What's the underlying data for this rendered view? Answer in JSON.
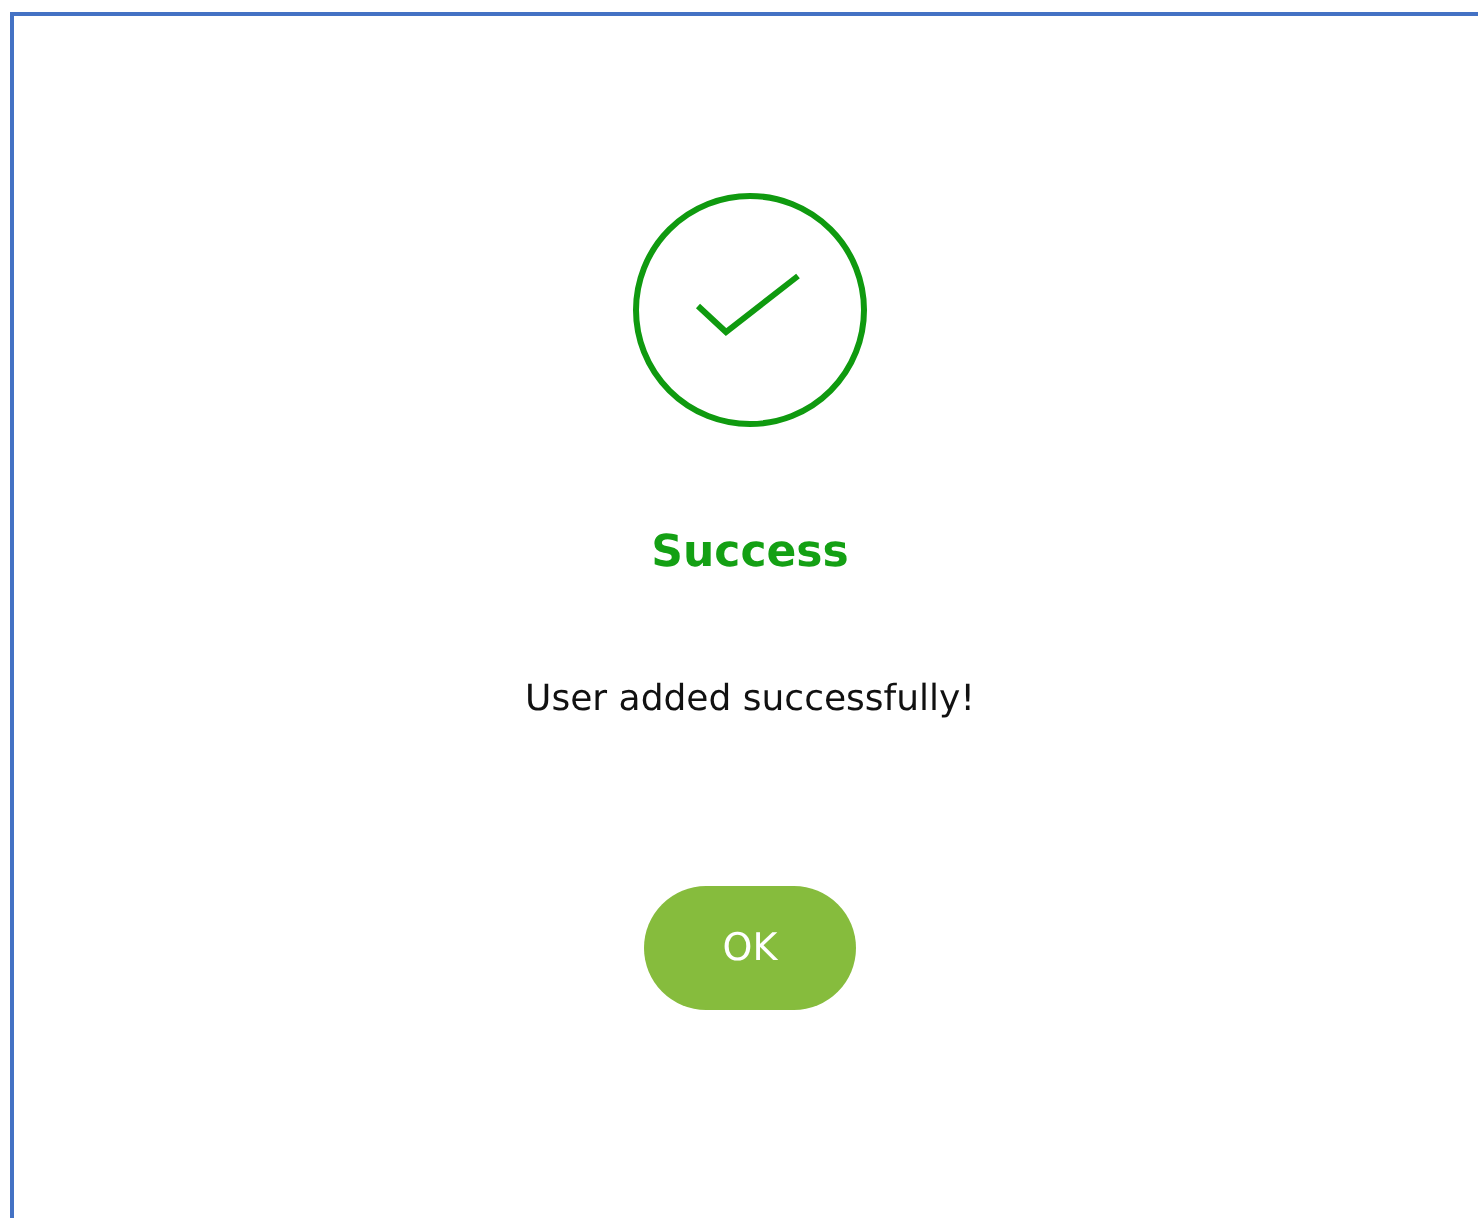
{
  "dialog": {
    "title": "Success",
    "message": "User added successfully!",
    "buttons": [
      "OK"
    ]
  }
}
